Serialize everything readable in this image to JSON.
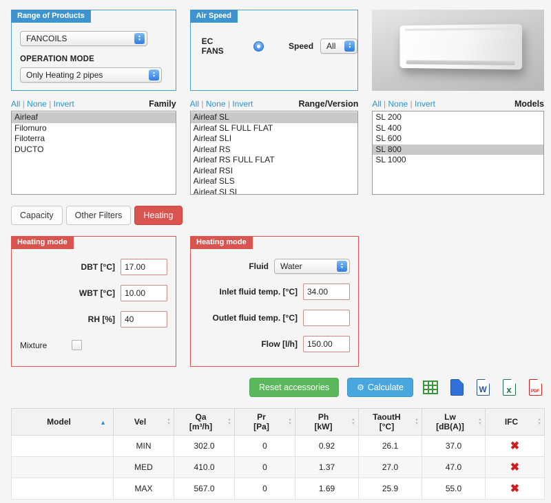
{
  "range_panel": {
    "title": "Range of Products",
    "product_select": "FANCOILS",
    "operation_mode_label": "OPERATION MODE",
    "operation_mode_select": "Only Heating 2 pipes"
  },
  "air_panel": {
    "title": "Air Speed",
    "ec_fans_label": "EC FANS",
    "speed_label": "Speed",
    "speed_select": "All"
  },
  "list_links": {
    "all": "All",
    "none": "None",
    "invert": "Invert",
    "sep": "|"
  },
  "family": {
    "title": "Family",
    "items": [
      "Airleaf",
      "Filomuro",
      "Filoterra",
      "DUCTO"
    ],
    "selected": "Airleaf"
  },
  "range_version": {
    "title": "Range/Version",
    "items": [
      "Airleaf SL",
      "Airleaf SL FULL FLAT",
      "Airleaf SLI",
      "Airleaf RS",
      "Airleaf RS FULL FLAT",
      "Airleaf RSI",
      "Airleaf SLS",
      "Airleaf SLSI"
    ],
    "selected": "Airleaf SL"
  },
  "models": {
    "title": "Models",
    "items": [
      "SL 200",
      "SL 400",
      "SL 600",
      "SL 800",
      "SL 1000"
    ],
    "selected": "SL 800"
  },
  "tabs": {
    "capacity": "Capacity",
    "other_filters": "Other Filters",
    "heating": "Heating",
    "active": "Heating"
  },
  "heating_air": {
    "title": "Heating mode",
    "fields": [
      {
        "label": "DBT [°C]",
        "value": "17.00"
      },
      {
        "label": "WBT [°C]",
        "value": "10.00"
      },
      {
        "label": "RH [%]",
        "value": "40"
      }
    ],
    "mixture_label": "Mixture",
    "mixture_checked": false
  },
  "heating_fluid": {
    "title": "Heating mode",
    "fluid_label": "Fluid",
    "fluid_select": "Water",
    "fields": [
      {
        "label": "Inlet fluid temp. [°C]",
        "value": "34.00"
      },
      {
        "label": "Outlet fluid temp. [°C]",
        "value": ""
      },
      {
        "label": "Flow [l/h]",
        "value": "150.00"
      }
    ]
  },
  "actions": {
    "reset_label": "Reset accessories",
    "calculate_label": "Calculate",
    "calculate_icon": "⚙"
  },
  "results_table": {
    "columns": [
      {
        "label": "Model",
        "unit": ""
      },
      {
        "label": "Vel",
        "unit": ""
      },
      {
        "label": "Qa",
        "unit": "[m³/h]"
      },
      {
        "label": "Pr",
        "unit": "[Pa]"
      },
      {
        "label": "Ph",
        "unit": "[kW]"
      },
      {
        "label": "TaoutH",
        "unit": "[°C]"
      },
      {
        "label": "Lw",
        "unit": "[dB(A)]"
      },
      {
        "label": "IFC",
        "unit": ""
      }
    ],
    "rows": [
      [
        "",
        "MIN",
        "302.0",
        "0",
        "0.92",
        "26.1",
        "37.0",
        "✖"
      ],
      [
        "",
        "MED",
        "410.0",
        "0",
        "1.37",
        "27.0",
        "47.0",
        "✖"
      ],
      [
        "",
        "MAX",
        "567.0",
        "0",
        "1.69",
        "25.9",
        "55.0",
        "✖"
      ]
    ]
  }
}
